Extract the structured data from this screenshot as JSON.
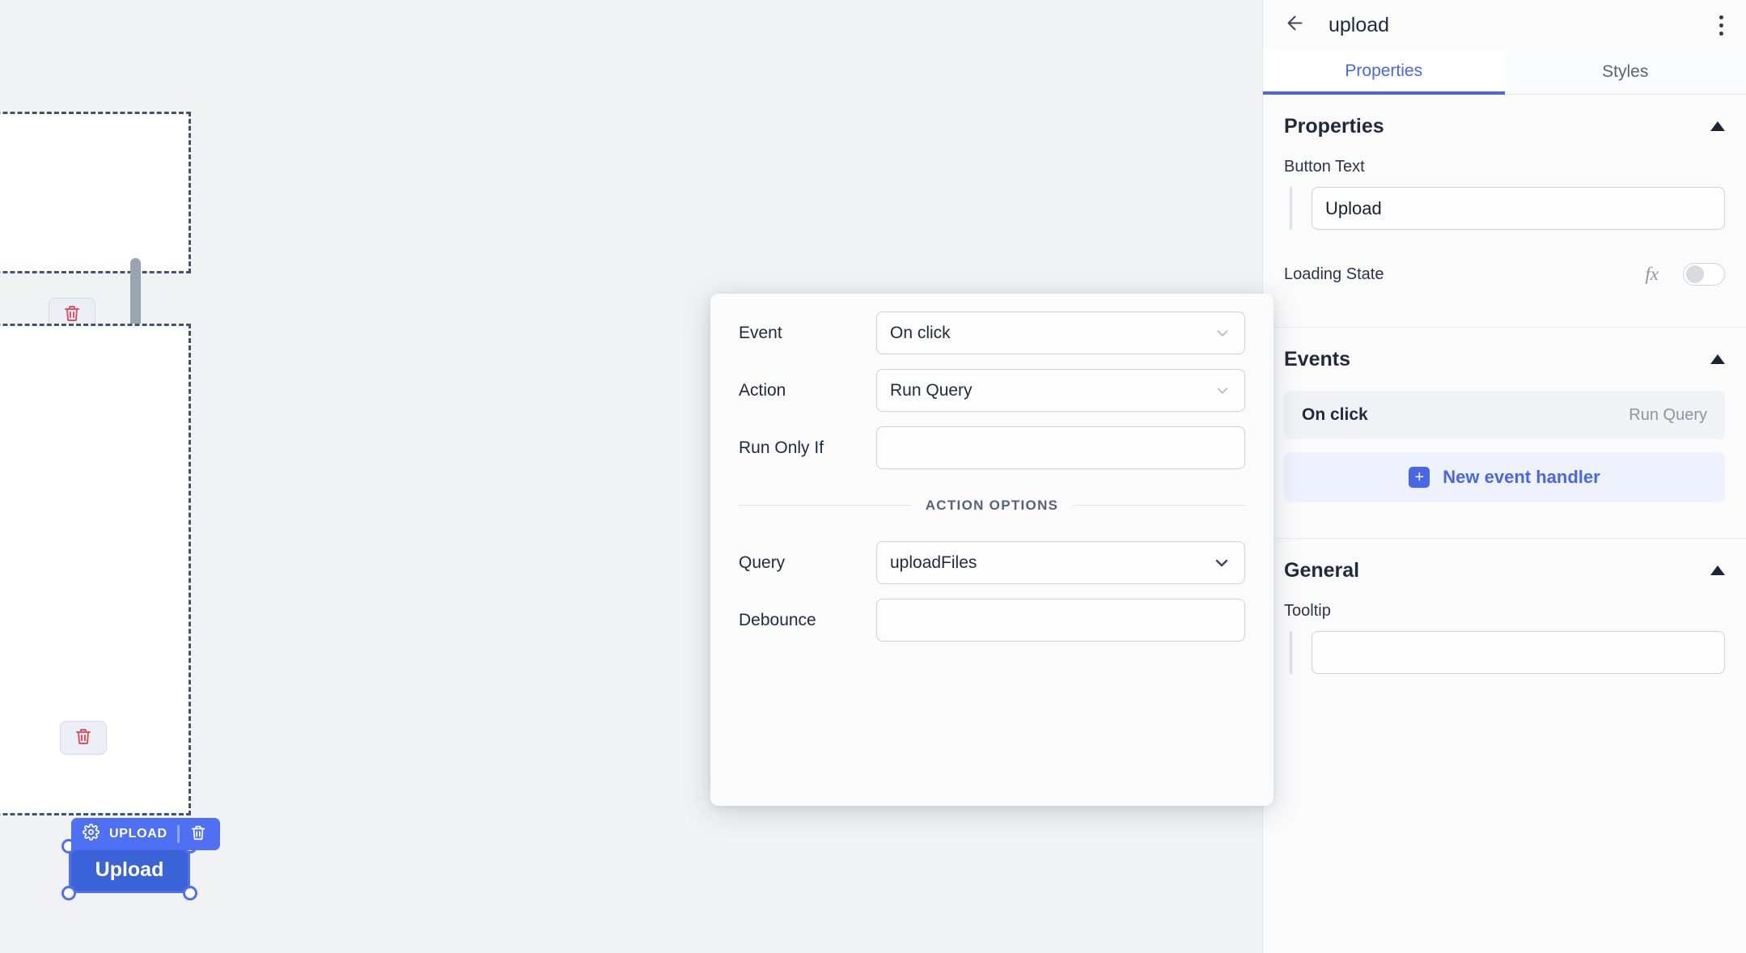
{
  "canvas": {
    "drop_zones": [
      {
        "name": "upper-drop-zone",
        "delete_icon": "trash-icon"
      },
      {
        "name": "lower-drop-zone",
        "delete_icon": "trash-icon"
      }
    ],
    "selected_widget": {
      "badge_label": "UPLOAD",
      "badge_settings_icon": "gear-icon",
      "badge_delete_icon": "trash-icon",
      "button_label": "Upload",
      "button_color": "#3b63d8",
      "selection_color": "#4f70f2"
    }
  },
  "modal": {
    "rows": [
      {
        "label": "Event",
        "value": "On click",
        "type": "select"
      },
      {
        "label": "Action",
        "value": "Run Query",
        "type": "select"
      },
      {
        "label": "Run Only If",
        "value": "",
        "type": "text"
      }
    ],
    "divider_label": "ACTION OPTIONS",
    "option_rows": [
      {
        "label": "Query",
        "value": "uploadFiles",
        "type": "select"
      },
      {
        "label": "Debounce",
        "value": "",
        "type": "text"
      }
    ]
  },
  "panel": {
    "header": {
      "back_icon": "back-arrow-icon",
      "title": "upload",
      "menu_icon": "more-vertical-icon"
    },
    "tabs": [
      {
        "label": "Properties",
        "active": true
      },
      {
        "label": "Styles",
        "active": false
      }
    ],
    "accent_color": "#4767e8",
    "sections": {
      "properties": {
        "title": "Properties",
        "button_text_label": "Button Text",
        "button_text_value": "Upload",
        "loading_state_label": "Loading State",
        "fx_label": "fx",
        "loading_state_on": false
      },
      "events": {
        "title": "Events",
        "handlers": [
          {
            "event": "On click",
            "action": "Run Query"
          }
        ],
        "new_handler_label": "New event handler",
        "new_handler_icon": "plus-icon"
      },
      "general": {
        "title": "General",
        "tooltip_label": "Tooltip",
        "tooltip_value": ""
      }
    }
  }
}
